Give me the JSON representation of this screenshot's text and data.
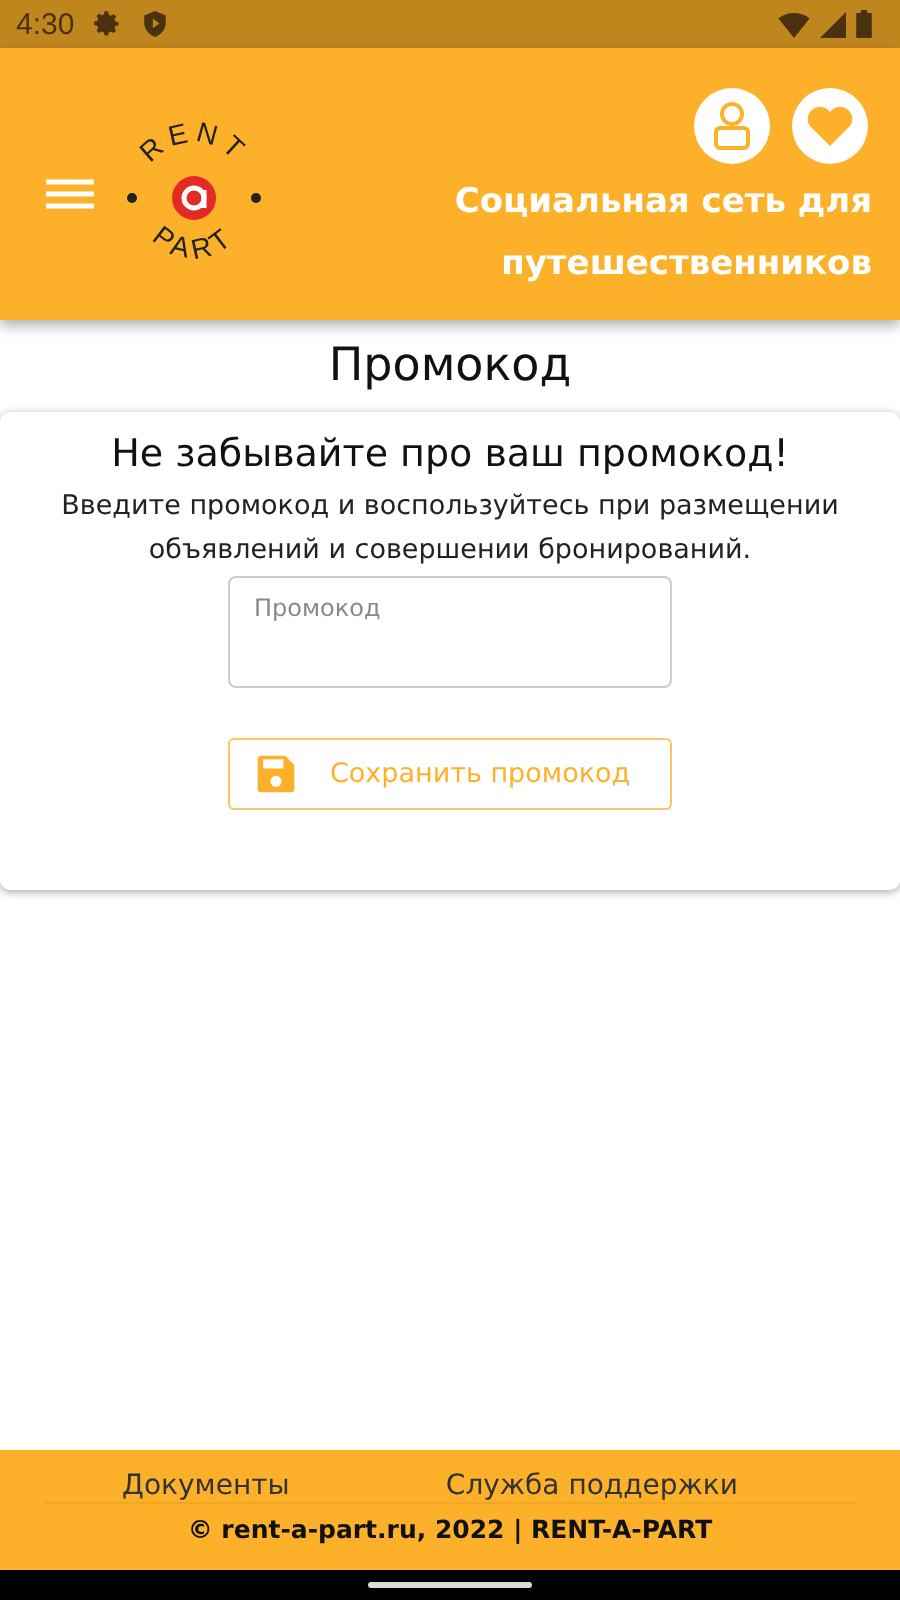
{
  "status_bar": {
    "time": "4:30"
  },
  "header": {
    "logo": {
      "top": "RENT",
      "bottom": "PART"
    },
    "tagline": "Социальная сеть для путешественников"
  },
  "page_title": "Промокод",
  "card": {
    "heading": "Не забывайте про ваш промокод!",
    "text": "Введите промокод и воспользуйтесь при размещении объявлений и совершении бронирований.",
    "field": {
      "placeholder": "Промокод"
    },
    "button": "Сохранить промокод"
  },
  "footer": {
    "links": [
      "Документы",
      "Служба поддержки"
    ],
    "copyright": "© rent-a-part.ru, 2022 | RENT-A-PART"
  }
}
